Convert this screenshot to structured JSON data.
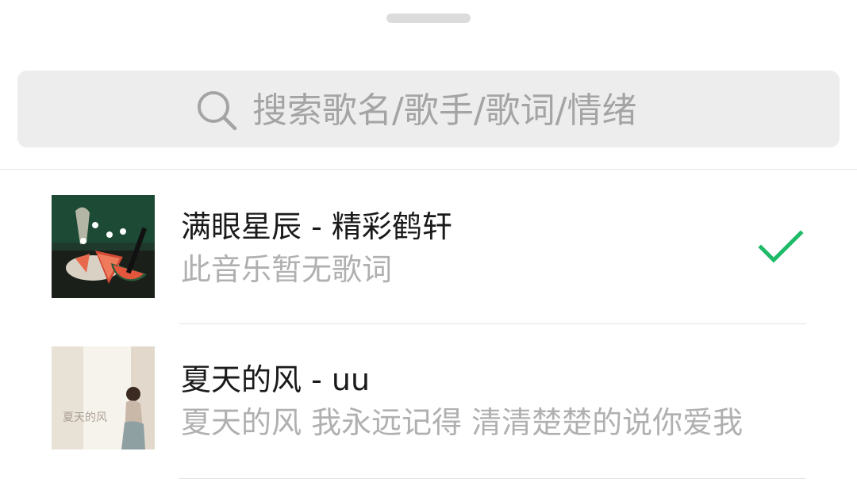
{
  "search": {
    "placeholder": "搜索歌名/歌手/歌词/情绪",
    "icon": "search-icon"
  },
  "songs": [
    {
      "title": "满眼星辰 - 精彩鹤轩",
      "lyric": "此音乐暂无歌词",
      "selected": true,
      "cover_icon": "album-cover"
    },
    {
      "title": "夏天的风 - uu",
      "lyric": "夏天的风 我永远记得 清清楚楚的说你爱我",
      "selected": false,
      "cover_icon": "album-cover"
    }
  ],
  "colors": {
    "accent_check": "#1fba69",
    "placeholder_text": "#a4a4a4",
    "lyric_text": "#b0b0b0",
    "search_background": "#ededed"
  }
}
